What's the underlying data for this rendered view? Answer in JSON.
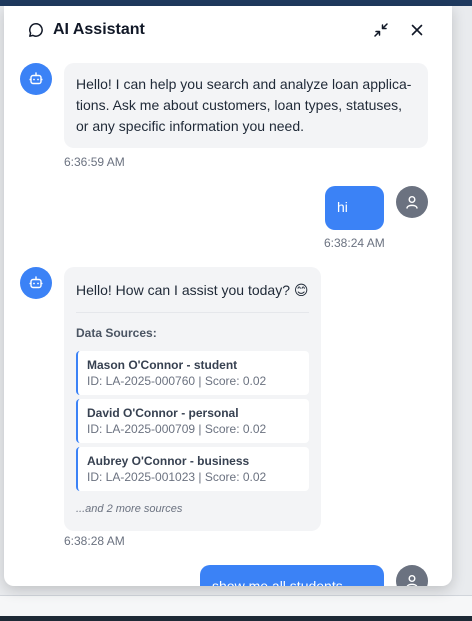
{
  "header": {
    "title": "AI Assistant"
  },
  "messages": [
    {
      "role": "bot",
      "text": "Hello! I can help you search and analyze loan applica-tions. Ask me about customers, loan types, statuses, or any specific information you need.",
      "time": "6:36:59 AM"
    },
    {
      "role": "user",
      "text": "hi",
      "time": "6:38:24 AM"
    },
    {
      "role": "bot",
      "text": "Hello! How can I assist you today? 😊",
      "time": "6:38:28 AM",
      "sources_title": "Data Sources:",
      "sources": [
        {
          "name": "Mason O'Connor - student",
          "meta": "ID: LA-2025-000760 | Score: 0.02"
        },
        {
          "name": "David O'Connor - personal",
          "meta": "ID: LA-2025-000709 | Score: 0.02"
        },
        {
          "name": "Aubrey O'Connor - business",
          "meta": "ID: LA-2025-001023 | Score: 0.02"
        }
      ],
      "more": "...and 2 more sources"
    },
    {
      "role": "user",
      "text": "show me all students loan"
    }
  ],
  "colors": {
    "accent": "#3b82f6",
    "user_avatar": "#6b7280",
    "bot_bubble": "#f3f4f6"
  }
}
